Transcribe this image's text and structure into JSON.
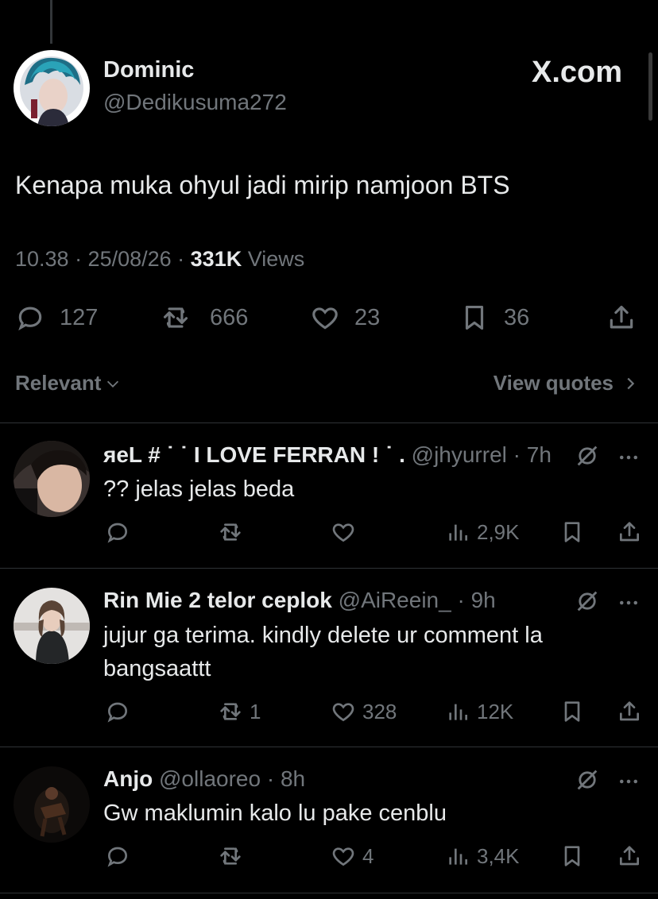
{
  "tweet": {
    "author_name": "Dominic",
    "author_handle": "@Dedikusuma272",
    "brand": "X.com",
    "text": "Kenapa muka ohyul jadi mirip namjoon BTS",
    "time": "10.38 · 25/08/26 · ",
    "views_count": "331K",
    "views_label": " Views",
    "actions": {
      "replies": "127",
      "reposts": "666",
      "likes": "23",
      "bookmarks": "36"
    }
  },
  "filters": {
    "sort_label": "Relevant",
    "quotes_label": "View quotes"
  },
  "replies": [
    {
      "name": "яeL # ˙ ˙ I LOVE FERRAN ! ˙ .",
      "handle": "@jhyurrel",
      "time": " · 7h",
      "text": "?? jelas jelas beda",
      "replies": "",
      "reposts": "",
      "likes": "",
      "views": "2,9K"
    },
    {
      "name": "Rin Mie 2 telor ceplok",
      "handle": "@AiReein_",
      "time": " · 9h",
      "text_line1": "jujur ga terima. kindly delete ur comment la",
      "text_line2": "bangsaattt",
      "replies": "",
      "reposts": "1",
      "likes": "328",
      "views": "12K"
    },
    {
      "name": "Anjo",
      "handle": "@ollaoreo",
      "time": " · 8h",
      "text": "Gw maklumin kalo lu pake cenblu",
      "replies": "",
      "reposts": "",
      "likes": "4",
      "views": "3,4K"
    }
  ],
  "colors": {
    "background": "#000000",
    "text_primary": "#e7e9ea",
    "text_secondary": "#71767b",
    "divider": "#2f3336"
  }
}
